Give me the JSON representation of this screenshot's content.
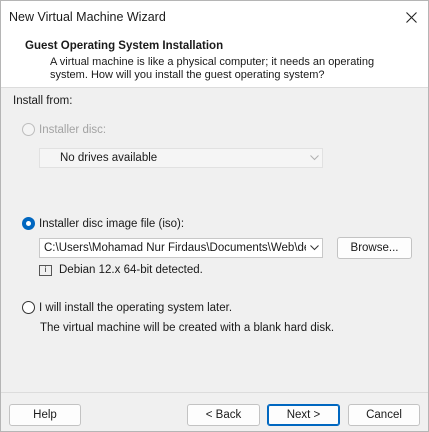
{
  "window": {
    "title": "New Virtual Machine Wizard"
  },
  "header": {
    "title": "Guest Operating System Installation",
    "description": "A virtual machine is like a physical computer; it needs an operating system. How will you install the guest operating system?"
  },
  "install_from": {
    "label": "Install from:",
    "options": [
      {
        "label": "Installer disc:",
        "selected": false,
        "enabled": false
      },
      {
        "label": "Installer disc image file (iso):",
        "selected": true,
        "enabled": true
      },
      {
        "label": "I will install the operating system later.",
        "selected": false,
        "enabled": true
      }
    ],
    "disc_dropdown": {
      "value": "No drives available"
    },
    "iso_path": {
      "value": "C:\\Users\\Mohamad Nur Firdaus\\Documents\\Web\\debia"
    },
    "browse_label": "Browse...",
    "detected_text": "Debian 12.x 64-bit detected.",
    "later_description": "The virtual machine will be created with a blank hard disk."
  },
  "footer": {
    "help": "Help",
    "back": "< Back",
    "next": "Next >",
    "cancel": "Cancel"
  },
  "colors": {
    "accent": "#0067c0",
    "header_bg": "#ffffff",
    "body_bg": "#f0f0f0"
  }
}
